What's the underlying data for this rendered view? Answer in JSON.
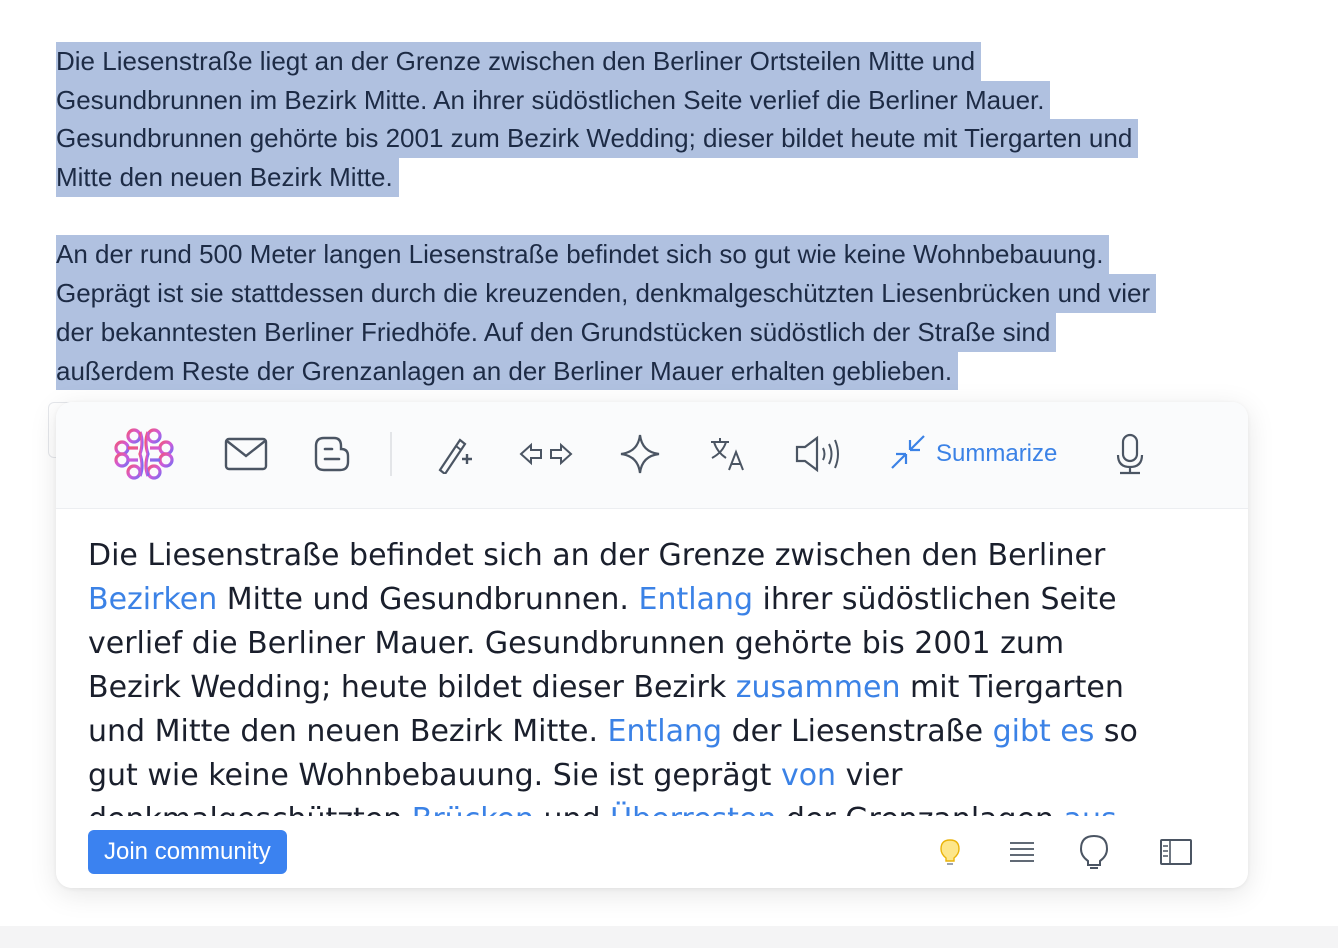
{
  "article": {
    "lines": [
      "Die Liesenstraße liegt an der Grenze zwischen den Berliner Ortsteilen Mitte und",
      "Gesundbrunnen im Bezirk Mitte. An ihrer südöstlichen Seite verlief die Berliner Mauer.",
      "Gesundbrunnen gehörte bis 2001 zum Bezirk Wedding; dieser bildet heute mit Tiergarten und",
      "Mitte den neuen Bezirk Mitte.",
      "",
      "An der rund 500 Meter langen Liesenstraße befindet sich so gut wie keine Wohnbebauung.",
      "Geprägt ist sie stattdessen durch die kreuzenden, denkmalgeschützten Liesenbrücken und vier",
      "der bekanntesten Berliner Friedhöfe. Auf den Grundstücken südöstlich der Straße sind",
      "außerdem Reste der Grenzanlagen an der Berliner Mauer erhalten geblieben."
    ]
  },
  "toolbar": {
    "icons": [
      "brain-logo-icon",
      "mail-icon",
      "blogger-icon",
      "magic-wand-icon",
      "arrows-left-right-icon",
      "sparkle-icon",
      "translate-icon",
      "speaker-icon",
      "summarize-icon",
      "microphone-icon"
    ],
    "active_mode_label": "Summarize",
    "accent_color": "#3b82e6"
  },
  "result": {
    "tokens": [
      {
        "t": "Die Liesenstraße befindet sich an der Grenze zwischen den Berliner ",
        "h": false
      },
      {
        "t": "Bezirken",
        "h": true
      },
      {
        "t": " Mitte und Gesundbrunnen. ",
        "h": false
      },
      {
        "t": "Entlang",
        "h": true
      },
      {
        "t": " ihrer südöstlichen Seite verlief die Berliner Mauer. Gesundbrunnen gehörte bis 2001 zum Bezirk Wedding; heute bildet dieser Bezirk ",
        "h": false
      },
      {
        "t": "zusammen",
        "h": true
      },
      {
        "t": " mit Tiergarten und Mitte den neuen Bezirk Mitte. ",
        "h": false
      },
      {
        "t": "Entlang",
        "h": true
      },
      {
        "t": " der Liesenstraße ",
        "h": false
      },
      {
        "t": "gibt es",
        "h": true
      },
      {
        "t": " so gut wie keine Wohnbebauung. Sie ist geprägt ",
        "h": false
      },
      {
        "t": "von",
        "h": true
      },
      {
        "t": " vier denkmalgeschützten ",
        "h": false
      },
      {
        "t": "Brücken",
        "h": true
      },
      {
        "t": " und ",
        "h": false
      },
      {
        "t": "Überresten",
        "h": true
      },
      {
        "t": " der Grenzanlagen ",
        "h": false
      },
      {
        "t": "aus",
        "h": true
      }
    ]
  },
  "footer": {
    "join_label": "Join community",
    "icons": [
      "lightbulb-on-icon",
      "text-align-icon",
      "lightbulb-outline-icon",
      "sidebar-panel-icon"
    ]
  }
}
